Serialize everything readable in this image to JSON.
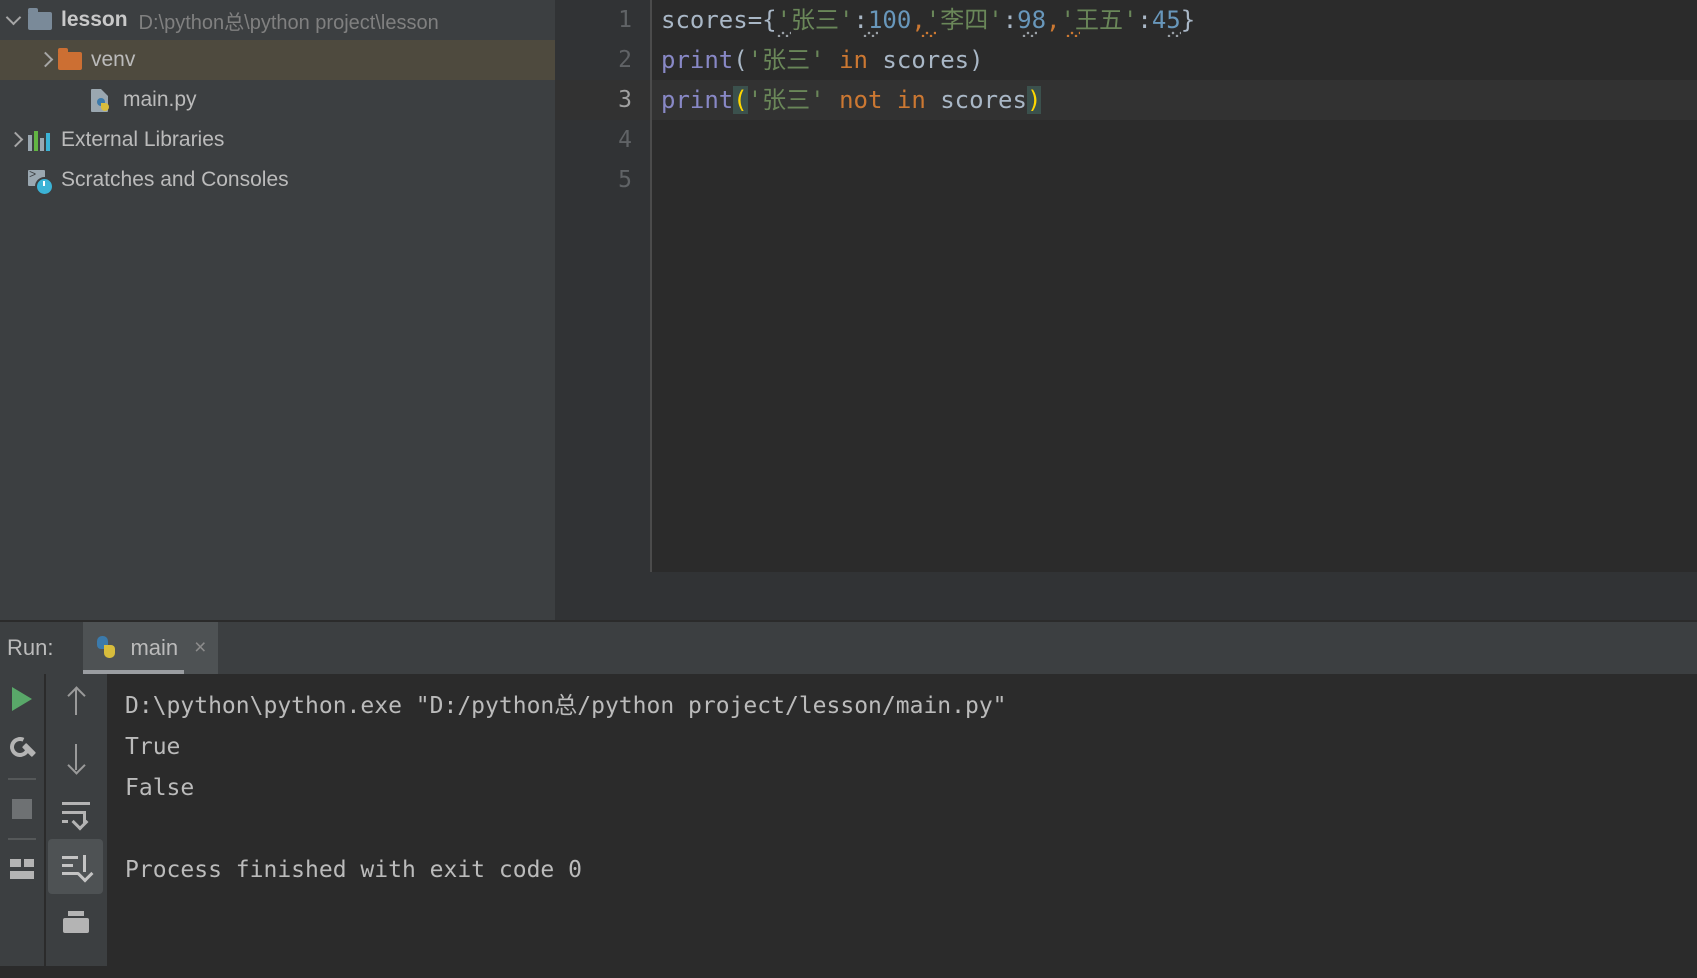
{
  "project_tree": {
    "name": "project-tree",
    "items": [
      {
        "label": "lesson",
        "path": "D:\\python总\\python project\\lesson",
        "icon": "folder-gray-icon",
        "expanded": true,
        "bold": true,
        "indent": 0,
        "selected": false
      },
      {
        "label": "venv",
        "path": "",
        "icon": "folder-orange-icon",
        "expanded": false,
        "bold": false,
        "indent": 1,
        "selected": true
      },
      {
        "label": "main.py",
        "path": "",
        "icon": "python-file-icon",
        "expanded": null,
        "bold": false,
        "indent": 2,
        "selected": false
      },
      {
        "label": "External Libraries",
        "path": "",
        "icon": "libraries-bars-icon",
        "expanded": false,
        "bold": false,
        "indent": 0,
        "selected": false
      },
      {
        "label": "Scratches and Consoles",
        "path": "",
        "icon": "scratches-clock-icon",
        "expanded": null,
        "bold": false,
        "indent": 0,
        "selected": false
      }
    ]
  },
  "editor": {
    "gutter_numbers": [
      "1",
      "2",
      "3",
      "4",
      "5"
    ],
    "active_line": 3,
    "lines": [
      {
        "number": "1",
        "plain": "scores={'张三':100,'李四':98,'王五':45}",
        "tokens": [
          {
            "t": "scores",
            "c": "tok-var"
          },
          {
            "t": "=",
            "c": "tok-punct"
          },
          {
            "t": "{",
            "c": "tok-punct"
          },
          {
            "t": "'张三'",
            "c": "tok-str"
          },
          {
            "t": ":",
            "c": "tok-punct"
          },
          {
            "t": "100",
            "c": "tok-num"
          },
          {
            "t": ",",
            "c": "tok-kw"
          },
          {
            "t": "'李四'",
            "c": "tok-str"
          },
          {
            "t": ":",
            "c": "tok-punct"
          },
          {
            "t": "98",
            "c": "tok-num"
          },
          {
            "t": ",",
            "c": "tok-kw"
          },
          {
            "t": "'王五'",
            "c": "tok-str"
          },
          {
            "t": ":",
            "c": "tok-punct"
          },
          {
            "t": "45",
            "c": "tok-num"
          },
          {
            "t": "}",
            "c": "tok-punct"
          }
        ]
      },
      {
        "number": "2",
        "plain": "print('张三' in scores)",
        "tokens": [
          {
            "t": "print",
            "c": "tok-fn"
          },
          {
            "t": "(",
            "c": "tok-punct"
          },
          {
            "t": "'张三'",
            "c": "tok-str"
          },
          {
            "t": " ",
            "c": "tok-punct"
          },
          {
            "t": "in",
            "c": "tok-kw"
          },
          {
            "t": " ",
            "c": "tok-punct"
          },
          {
            "t": "scores",
            "c": "tok-var"
          },
          {
            "t": ")",
            "c": "tok-punct"
          }
        ]
      },
      {
        "number": "3",
        "plain": "print('张三' not in scores)",
        "tokens": [
          {
            "t": "print",
            "c": "tok-fn"
          },
          {
            "t": "(",
            "c": "tok-brace-hl"
          },
          {
            "t": "'张三'",
            "c": "tok-str"
          },
          {
            "t": " ",
            "c": "tok-punct"
          },
          {
            "t": "not",
            "c": "tok-kw"
          },
          {
            "t": " ",
            "c": "tok-punct"
          },
          {
            "t": "in",
            "c": "tok-kw"
          },
          {
            "t": " ",
            "c": "tok-punct"
          },
          {
            "t": "scores",
            "c": "tok-var"
          },
          {
            "t": ")",
            "c": "tok-brace-hl"
          }
        ]
      },
      {
        "number": "4",
        "plain": "",
        "tokens": []
      },
      {
        "number": "5",
        "plain": "",
        "tokens": []
      }
    ]
  },
  "run_panel": {
    "run_label": "Run:",
    "tab_label": "main",
    "tab_icon": "python-icon",
    "tab_close": "×",
    "toolbar_left": [
      {
        "name": "rerun-button",
        "icon": "play-icon"
      },
      {
        "name": "run-settings-button",
        "icon": "wrench-icon"
      },
      {
        "name": "stop-button",
        "icon": "stop-icon"
      },
      {
        "name": "layout-button",
        "icon": "grid-icon"
      }
    ],
    "toolbar_second": [
      {
        "name": "prev-occurrence-button",
        "icon": "arrow-up-icon"
      },
      {
        "name": "next-occurrence-button",
        "icon": "arrow-down-icon"
      },
      {
        "name": "soft-wrap-button",
        "icon": "soft-wrap-icon"
      },
      {
        "name": "scroll-to-end-button",
        "icon": "scroll-to-end-icon"
      },
      {
        "name": "print-button",
        "icon": "printer-icon"
      }
    ],
    "console_lines": [
      "D:\\python\\python.exe \"D:/python总/python project/lesson/main.py\"",
      "True",
      "False",
      "",
      "Process finished with exit code 0"
    ]
  },
  "colors": {
    "sidebar_bg": "#3c3f41",
    "editor_bg": "#2b2b2b",
    "gutter_bg": "#313335",
    "selection_bg": "#4e4a3e",
    "current_line_bg": "#323232",
    "string_green": "#6a8759",
    "number_blue": "#6897bb",
    "keyword_orange": "#cc7832",
    "function_purple": "#8888c6",
    "default_text": "#a9b7c6",
    "brace_match_bg": "#3b514d",
    "brace_match_fg": "#ffd700",
    "run_green": "#59a869"
  }
}
